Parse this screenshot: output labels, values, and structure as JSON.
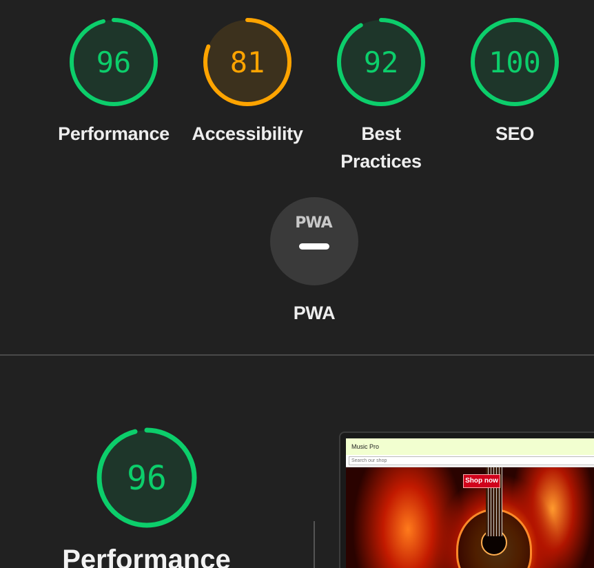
{
  "colors": {
    "pass": "#0cce6b",
    "average": "#ffa400",
    "neutral": "#3a3a3a"
  },
  "categories": [
    {
      "score": "96",
      "score_value": 96,
      "label": "Performance",
      "status": "pass"
    },
    {
      "score": "81",
      "score_value": 81,
      "label": "Accessibility",
      "status": "average"
    },
    {
      "score": "92",
      "score_value": 92,
      "label": "Best Practices",
      "label_line1": "Best",
      "label_line2": "Practices",
      "status": "pass"
    },
    {
      "score": "100",
      "score_value": 100,
      "label": "SEO",
      "status": "pass"
    }
  ],
  "pwa": {
    "badge_text": "PWA",
    "label": "PWA"
  },
  "performance_section": {
    "score": "96",
    "score_value": 96,
    "title": "Performance"
  },
  "screenshot": {
    "site_name": "Music Pro",
    "search_placeholder": "Search our shop",
    "cta_label": "Shop now"
  }
}
